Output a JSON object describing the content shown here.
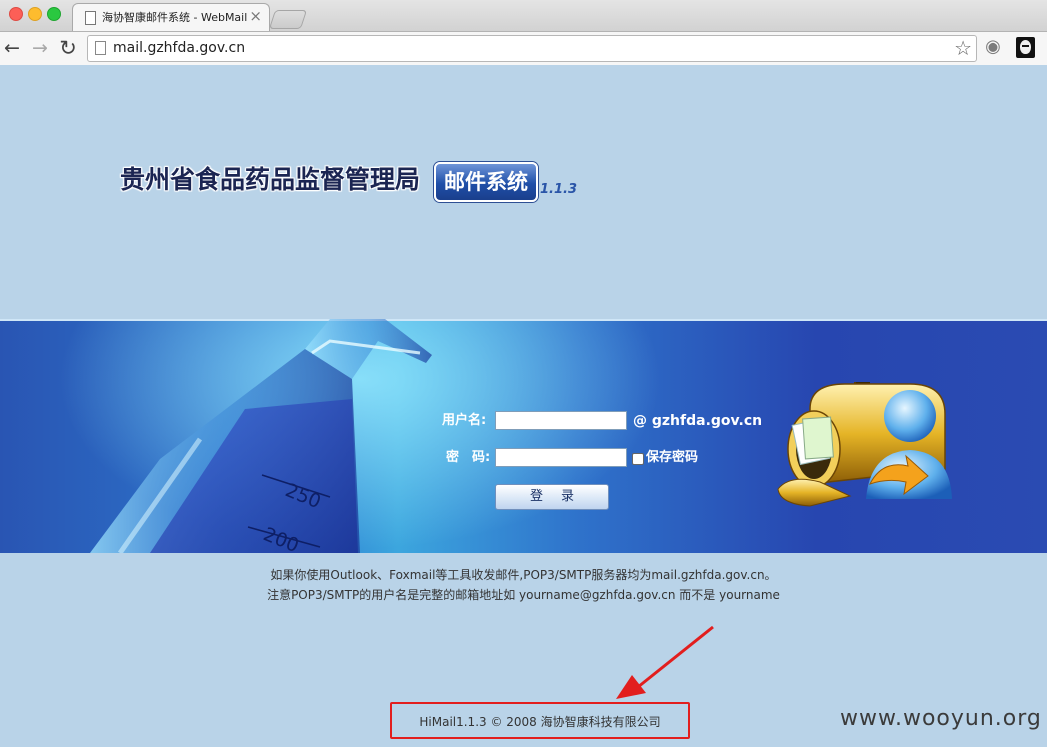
{
  "browser": {
    "tab_title": "海协智康邮件系统 - WebMail",
    "url": "mail.gzhfda.gov.cn"
  },
  "icons": {
    "back": "←",
    "forward": "→",
    "reload": "↻",
    "star": "☆",
    "tab_close": "×",
    "globe": "◉"
  },
  "logo": {
    "title": "贵州省食品药品监督管理局",
    "badge": "邮件系统",
    "version": "1.1.3"
  },
  "login": {
    "username_label": "用户名:",
    "password_label": "密　码:",
    "domain": "@ gzhfda.gov.cn",
    "remember_label": "保存密码",
    "submit_label": "登录"
  },
  "flask_marks": [
    "250",
    "200"
  ],
  "info": {
    "line1": "如果你使用Outlook、Foxmail等工具收发邮件,POP3/SMTP服务器均为mail.gzhfda.gov.cn。",
    "line2": "注意POP3/SMTP的用户名是完整的邮箱地址如 yourname@gzhfda.gov.cn 而不是 yourname"
  },
  "footer": {
    "copyright": "HiMail1.1.3 © 2008 海协智康科技有限公司"
  },
  "watermark": "www.wooyun.org",
  "colors": {
    "page_bg": "#b9d3e8",
    "band": "#2a5bbd",
    "highlight": "#e21e1e"
  }
}
